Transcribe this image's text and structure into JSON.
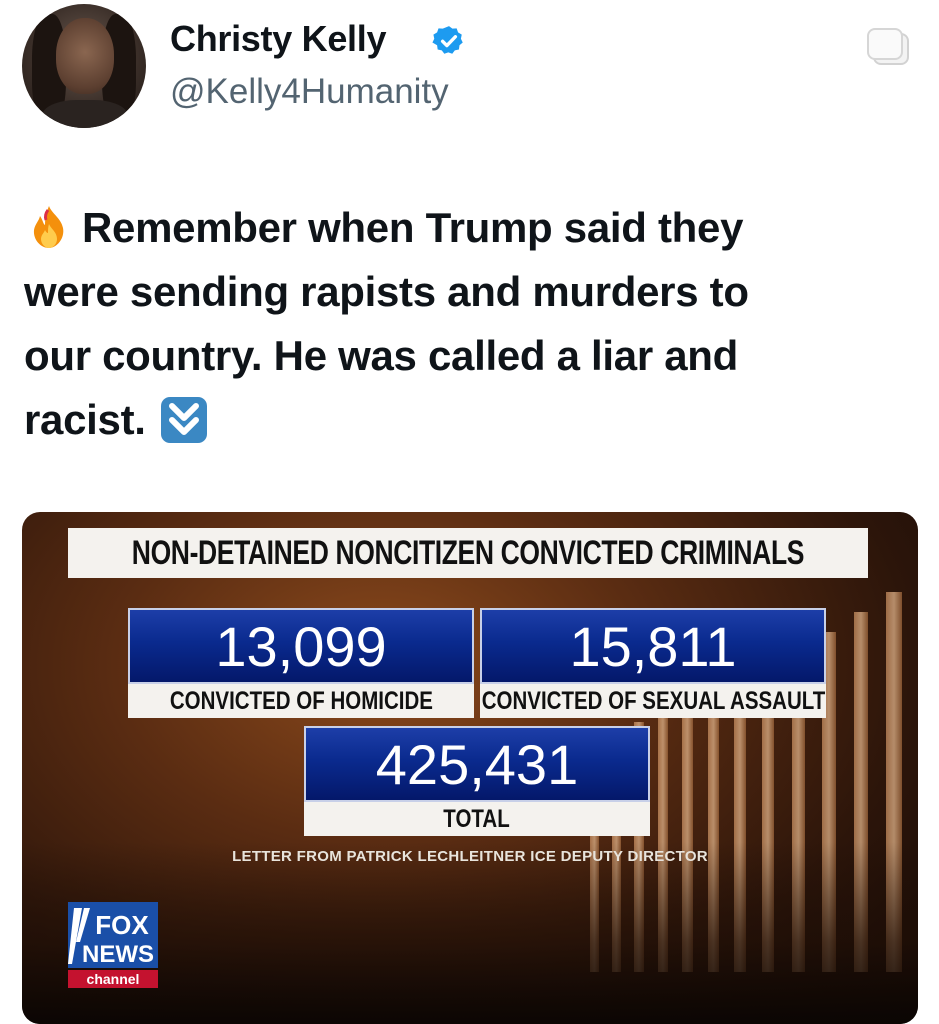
{
  "user": {
    "display_name": "Christy Kelly",
    "handle": "@Kelly4Humanity"
  },
  "tweet": {
    "line1": "Remember when Trump said they",
    "line2": "were sending rapists and murders to",
    "line3": "our country.  He was called a liar and",
    "line4": "racist.",
    "emoji_start": "fire-emoji",
    "emoji_end": "double-down-arrow-emoji"
  },
  "graphic": {
    "header": "NON-DETAINED NONCITIZEN CONVICTED CRIMINALS",
    "stats": [
      {
        "value": "13,099",
        "label": "CONVICTED OF HOMICIDE"
      },
      {
        "value": "15,811",
        "label": "CONVICTED OF SEXUAL ASSAULT"
      },
      {
        "value": "425,431",
        "label": "TOTAL"
      }
    ],
    "source": "LETTER FROM PATRICK LECHLEITNER ICE DEPUTY DIRECTOR",
    "logo": {
      "line1": "FOX",
      "line2": "NEWS",
      "line3": "channel"
    }
  },
  "colors": {
    "verified": "#1d9bf0",
    "stat_blue": "#0a2a8e",
    "handle_gray": "#536471"
  }
}
